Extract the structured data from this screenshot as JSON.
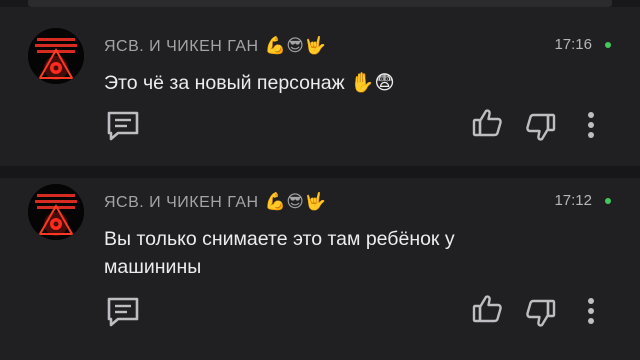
{
  "comments": [
    {
      "author": "ЯСВ. И ЧИКЕН ГАН",
      "author_emojis": "💪😎🤟",
      "time": "17:16",
      "text": "Это чё за новый персонаж",
      "text_emojis": "✋😨"
    },
    {
      "author": "ЯСВ. И ЧИКЕН ГАН",
      "author_emojis": "💪😎🤟",
      "time": "17:12",
      "text": "Вы только снимаете это там ребёнок у машинины",
      "text_emojis": ""
    }
  ],
  "colors": {
    "background": "#202022",
    "separator": "#17171a",
    "online_dot": "#43c85e",
    "icon": "#bdbdc2"
  },
  "icons": [
    "reply-icon",
    "like-icon",
    "dislike-icon",
    "more-icon",
    "online-dot"
  ]
}
